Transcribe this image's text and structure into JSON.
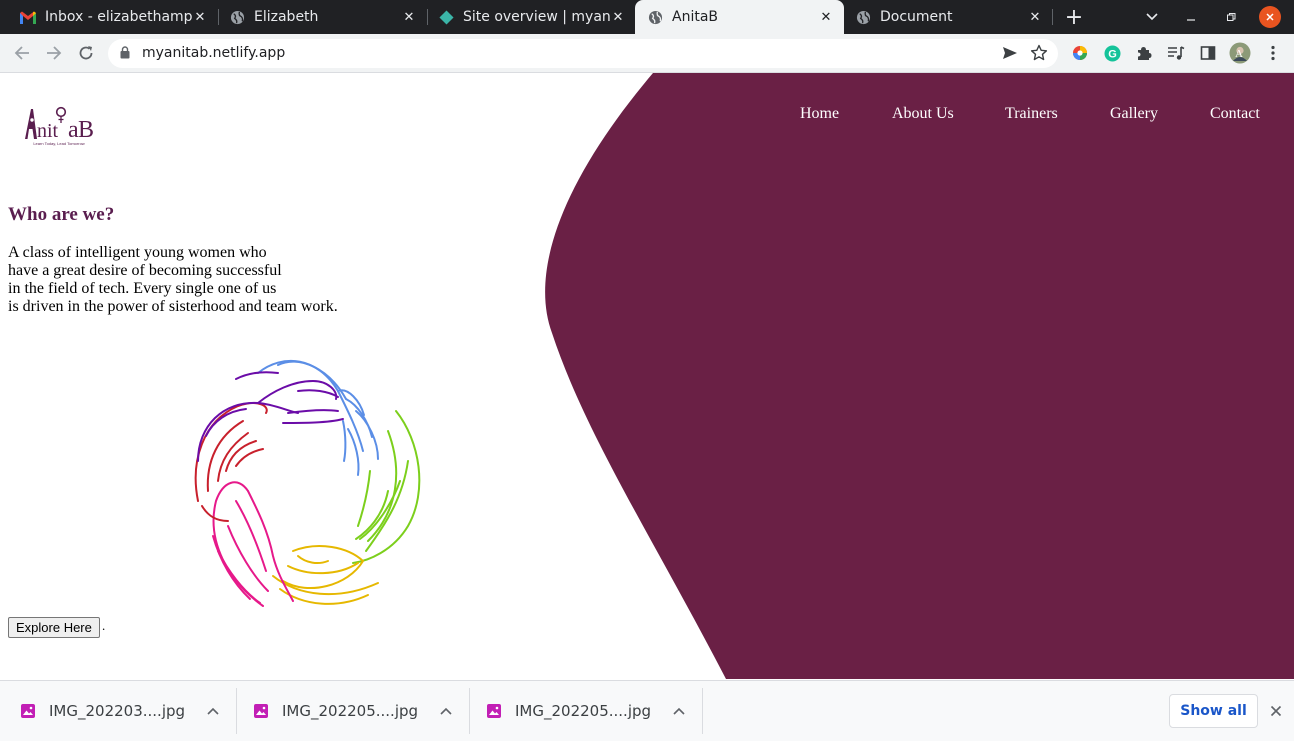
{
  "browser": {
    "tabs": [
      {
        "title": "Inbox - elizabethampi",
        "favicon": "gmail-icon",
        "active": false
      },
      {
        "title": "Elizabeth",
        "favicon": "globe-icon",
        "active": false
      },
      {
        "title": "Site overview | myanit",
        "favicon": "netlify-icon",
        "active": false
      },
      {
        "title": "AnitaB",
        "favicon": "globe-icon",
        "active": true
      },
      {
        "title": "Document",
        "favicon": "globe-icon",
        "active": false
      }
    ],
    "close_glyph": "✕",
    "new_tab_glyph": "+",
    "url": "myanitab.netlify.app"
  },
  "site": {
    "logo_text": "AnitaB",
    "logo_tagline": "Learn Today, Lead Tomorrow",
    "nav": [
      "Home",
      "About Us",
      "Trainers",
      "Gallery",
      "Contact"
    ],
    "headline": "Who are we?",
    "paragraph_lines": [
      "A class of intelligent young women who",
      "have a great desire of becoming successful",
      "in the field of tech. Every single one of us",
      "is driven in the power of sisterhood and team work."
    ],
    "button": "Explore Here",
    "trailing_text": ".",
    "colors": {
      "brand": "#6a2045",
      "headline": "#5a1e4f"
    }
  },
  "downloads": {
    "items": [
      "IMG_202203....jpg",
      "IMG_202205....jpg",
      "IMG_202205....jpg"
    ],
    "show_all": "Show all"
  }
}
